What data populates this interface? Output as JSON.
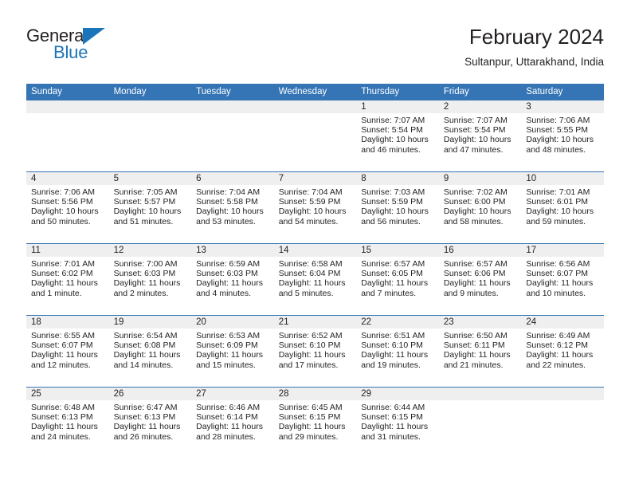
{
  "logo": {
    "word_one": "General",
    "word_two": "Blue",
    "triangle_color": "#1b75bb"
  },
  "header": {
    "title": "February 2024",
    "subtitle": "Sultanpur, Uttarakhand, India"
  },
  "colors": {
    "header_blue": "#3575b5",
    "daynum_band": "#efefef",
    "text": "#231f20"
  },
  "weekday_headers": [
    "Sunday",
    "Monday",
    "Tuesday",
    "Wednesday",
    "Thursday",
    "Friday",
    "Saturday"
  ],
  "labels": {
    "sunrise": "Sunrise:",
    "sunset": "Sunset:",
    "daylight": "Daylight:"
  },
  "weeks": [
    [
      {
        "day": "",
        "sunrise": "",
        "sunset": "",
        "daylight_line1": "",
        "daylight_line2": ""
      },
      {
        "day": "",
        "sunrise": "",
        "sunset": "",
        "daylight_line1": "",
        "daylight_line2": ""
      },
      {
        "day": "",
        "sunrise": "",
        "sunset": "",
        "daylight_line1": "",
        "daylight_line2": ""
      },
      {
        "day": "",
        "sunrise": "",
        "sunset": "",
        "daylight_line1": "",
        "daylight_line2": ""
      },
      {
        "day": "1",
        "sunrise": "Sunrise: 7:07 AM",
        "sunset": "Sunset: 5:54 PM",
        "daylight_line1": "Daylight: 10 hours",
        "daylight_line2": "and 46 minutes."
      },
      {
        "day": "2",
        "sunrise": "Sunrise: 7:07 AM",
        "sunset": "Sunset: 5:54 PM",
        "daylight_line1": "Daylight: 10 hours",
        "daylight_line2": "and 47 minutes."
      },
      {
        "day": "3",
        "sunrise": "Sunrise: 7:06 AM",
        "sunset": "Sunset: 5:55 PM",
        "daylight_line1": "Daylight: 10 hours",
        "daylight_line2": "and 48 minutes."
      }
    ],
    [
      {
        "day": "4",
        "sunrise": "Sunrise: 7:06 AM",
        "sunset": "Sunset: 5:56 PM",
        "daylight_line1": "Daylight: 10 hours",
        "daylight_line2": "and 50 minutes."
      },
      {
        "day": "5",
        "sunrise": "Sunrise: 7:05 AM",
        "sunset": "Sunset: 5:57 PM",
        "daylight_line1": "Daylight: 10 hours",
        "daylight_line2": "and 51 minutes."
      },
      {
        "day": "6",
        "sunrise": "Sunrise: 7:04 AM",
        "sunset": "Sunset: 5:58 PM",
        "daylight_line1": "Daylight: 10 hours",
        "daylight_line2": "and 53 minutes."
      },
      {
        "day": "7",
        "sunrise": "Sunrise: 7:04 AM",
        "sunset": "Sunset: 5:59 PM",
        "daylight_line1": "Daylight: 10 hours",
        "daylight_line2": "and 54 minutes."
      },
      {
        "day": "8",
        "sunrise": "Sunrise: 7:03 AM",
        "sunset": "Sunset: 5:59 PM",
        "daylight_line1": "Daylight: 10 hours",
        "daylight_line2": "and 56 minutes."
      },
      {
        "day": "9",
        "sunrise": "Sunrise: 7:02 AM",
        "sunset": "Sunset: 6:00 PM",
        "daylight_line1": "Daylight: 10 hours",
        "daylight_line2": "and 58 minutes."
      },
      {
        "day": "10",
        "sunrise": "Sunrise: 7:01 AM",
        "sunset": "Sunset: 6:01 PM",
        "daylight_line1": "Daylight: 10 hours",
        "daylight_line2": "and 59 minutes."
      }
    ],
    [
      {
        "day": "11",
        "sunrise": "Sunrise: 7:01 AM",
        "sunset": "Sunset: 6:02 PM",
        "daylight_line1": "Daylight: 11 hours",
        "daylight_line2": "and 1 minute."
      },
      {
        "day": "12",
        "sunrise": "Sunrise: 7:00 AM",
        "sunset": "Sunset: 6:03 PM",
        "daylight_line1": "Daylight: 11 hours",
        "daylight_line2": "and 2 minutes."
      },
      {
        "day": "13",
        "sunrise": "Sunrise: 6:59 AM",
        "sunset": "Sunset: 6:03 PM",
        "daylight_line1": "Daylight: 11 hours",
        "daylight_line2": "and 4 minutes."
      },
      {
        "day": "14",
        "sunrise": "Sunrise: 6:58 AM",
        "sunset": "Sunset: 6:04 PM",
        "daylight_line1": "Daylight: 11 hours",
        "daylight_line2": "and 5 minutes."
      },
      {
        "day": "15",
        "sunrise": "Sunrise: 6:57 AM",
        "sunset": "Sunset: 6:05 PM",
        "daylight_line1": "Daylight: 11 hours",
        "daylight_line2": "and 7 minutes."
      },
      {
        "day": "16",
        "sunrise": "Sunrise: 6:57 AM",
        "sunset": "Sunset: 6:06 PM",
        "daylight_line1": "Daylight: 11 hours",
        "daylight_line2": "and 9 minutes."
      },
      {
        "day": "17",
        "sunrise": "Sunrise: 6:56 AM",
        "sunset": "Sunset: 6:07 PM",
        "daylight_line1": "Daylight: 11 hours",
        "daylight_line2": "and 10 minutes."
      }
    ],
    [
      {
        "day": "18",
        "sunrise": "Sunrise: 6:55 AM",
        "sunset": "Sunset: 6:07 PM",
        "daylight_line1": "Daylight: 11 hours",
        "daylight_line2": "and 12 minutes."
      },
      {
        "day": "19",
        "sunrise": "Sunrise: 6:54 AM",
        "sunset": "Sunset: 6:08 PM",
        "daylight_line1": "Daylight: 11 hours",
        "daylight_line2": "and 14 minutes."
      },
      {
        "day": "20",
        "sunrise": "Sunrise: 6:53 AM",
        "sunset": "Sunset: 6:09 PM",
        "daylight_line1": "Daylight: 11 hours",
        "daylight_line2": "and 15 minutes."
      },
      {
        "day": "21",
        "sunrise": "Sunrise: 6:52 AM",
        "sunset": "Sunset: 6:10 PM",
        "daylight_line1": "Daylight: 11 hours",
        "daylight_line2": "and 17 minutes."
      },
      {
        "day": "22",
        "sunrise": "Sunrise: 6:51 AM",
        "sunset": "Sunset: 6:10 PM",
        "daylight_line1": "Daylight: 11 hours",
        "daylight_line2": "and 19 minutes."
      },
      {
        "day": "23",
        "sunrise": "Sunrise: 6:50 AM",
        "sunset": "Sunset: 6:11 PM",
        "daylight_line1": "Daylight: 11 hours",
        "daylight_line2": "and 21 minutes."
      },
      {
        "day": "24",
        "sunrise": "Sunrise: 6:49 AM",
        "sunset": "Sunset: 6:12 PM",
        "daylight_line1": "Daylight: 11 hours",
        "daylight_line2": "and 22 minutes."
      }
    ],
    [
      {
        "day": "25",
        "sunrise": "Sunrise: 6:48 AM",
        "sunset": "Sunset: 6:13 PM",
        "daylight_line1": "Daylight: 11 hours",
        "daylight_line2": "and 24 minutes."
      },
      {
        "day": "26",
        "sunrise": "Sunrise: 6:47 AM",
        "sunset": "Sunset: 6:13 PM",
        "daylight_line1": "Daylight: 11 hours",
        "daylight_line2": "and 26 minutes."
      },
      {
        "day": "27",
        "sunrise": "Sunrise: 6:46 AM",
        "sunset": "Sunset: 6:14 PM",
        "daylight_line1": "Daylight: 11 hours",
        "daylight_line2": "and 28 minutes."
      },
      {
        "day": "28",
        "sunrise": "Sunrise: 6:45 AM",
        "sunset": "Sunset: 6:15 PM",
        "daylight_line1": "Daylight: 11 hours",
        "daylight_line2": "and 29 minutes."
      },
      {
        "day": "29",
        "sunrise": "Sunrise: 6:44 AM",
        "sunset": "Sunset: 6:15 PM",
        "daylight_line1": "Daylight: 11 hours",
        "daylight_line2": "and 31 minutes."
      },
      {
        "day": "",
        "sunrise": "",
        "sunset": "",
        "daylight_line1": "",
        "daylight_line2": ""
      },
      {
        "day": "",
        "sunrise": "",
        "sunset": "",
        "daylight_line1": "",
        "daylight_line2": ""
      }
    ]
  ]
}
